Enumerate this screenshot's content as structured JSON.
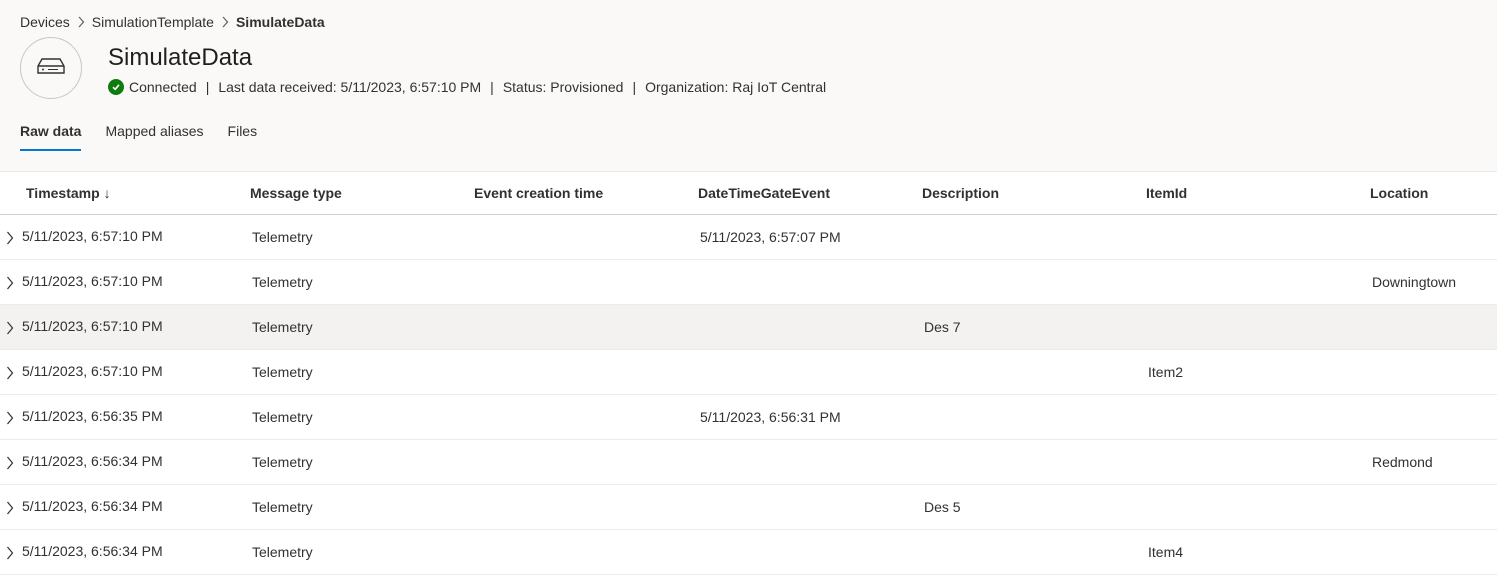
{
  "breadcrumb": {
    "items": [
      "Devices",
      "SimulationTemplate"
    ],
    "current": "SimulateData"
  },
  "device": {
    "name": "SimulateData",
    "icon": "device-icon",
    "connection_status": "Connected",
    "last_data": "Last data received: 5/11/2023, 6:57:10 PM",
    "status": "Status: Provisioned",
    "organization": "Organization: Raj IoT Central",
    "status_color": "#107c10"
  },
  "tabs": [
    {
      "label": "Raw data",
      "active": true
    },
    {
      "label": "Mapped aliases",
      "active": false
    },
    {
      "label": "Files",
      "active": false
    }
  ],
  "accent_color": "#0078d4",
  "table": {
    "columns": [
      "Timestamp",
      "Message type",
      "Event creation time",
      "DateTimeGateEvent",
      "Description",
      "ItemId",
      "Location"
    ],
    "sort_indicator": "↓",
    "rows": [
      [
        "5/11/2023, 6:57:10 PM",
        "Telemetry",
        "",
        "5/11/2023, 6:57:07 PM",
        "",
        "",
        ""
      ],
      [
        "5/11/2023, 6:57:10 PM",
        "Telemetry",
        "",
        "",
        "",
        "",
        "Downingtown"
      ],
      [
        "5/11/2023, 6:57:10 PM",
        "Telemetry",
        "",
        "",
        "Des 7",
        "",
        ""
      ],
      [
        "5/11/2023, 6:57:10 PM",
        "Telemetry",
        "",
        "",
        "",
        "Item2",
        ""
      ],
      [
        "5/11/2023, 6:56:35 PM",
        "Telemetry",
        "",
        "5/11/2023, 6:56:31 PM",
        "",
        "",
        ""
      ],
      [
        "5/11/2023, 6:56:34 PM",
        "Telemetry",
        "",
        "",
        "",
        "",
        "Redmond"
      ],
      [
        "5/11/2023, 6:56:34 PM",
        "Telemetry",
        "",
        "",
        "Des 5",
        "",
        ""
      ],
      [
        "5/11/2023, 6:56:34 PM",
        "Telemetry",
        "",
        "",
        "",
        "Item4",
        ""
      ]
    ]
  }
}
